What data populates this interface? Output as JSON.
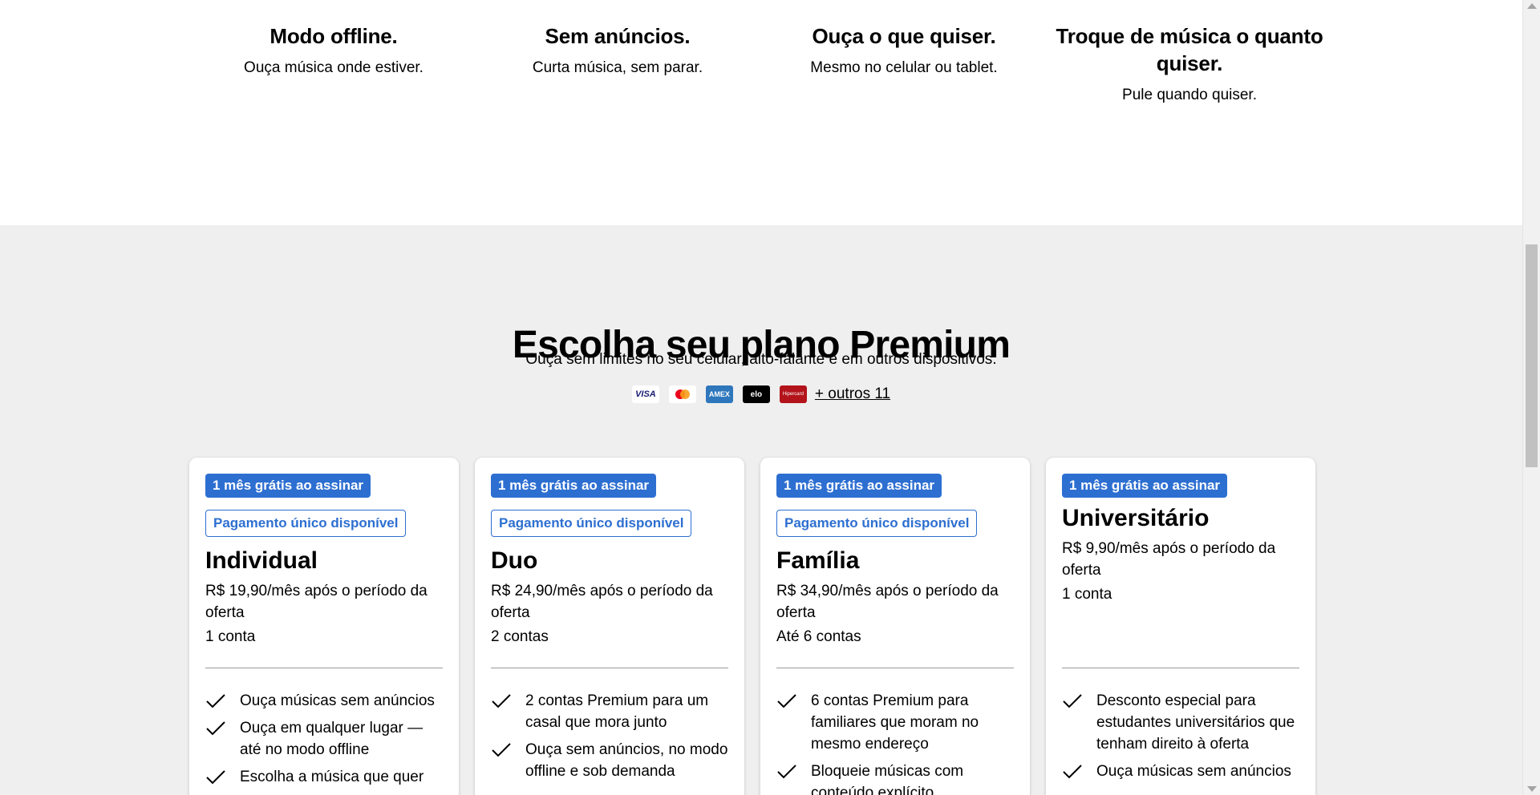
{
  "benefits": [
    {
      "title": "Modo offline.",
      "text": "Ouça música onde estiver."
    },
    {
      "title": "Sem anúncios.",
      "text": "Curta música, sem parar."
    },
    {
      "title": "Ouça o que quiser.",
      "text": "Mesmo no celular ou tablet."
    },
    {
      "title": "Troque de música o quanto quiser.",
      "text": "Pule quando quiser."
    }
  ],
  "premium": {
    "title": "Escolha seu plano Premium",
    "subtitle": "Ouça sem limites no seu celular, alto-falante e em outros dispositivos.",
    "payment_logos": [
      {
        "name": "visa-logo",
        "label": "VISA",
        "bg": "#ffffff",
        "fg": "#1a1f71"
      },
      {
        "name": "mastercard-logo",
        "label": "",
        "bg": "#ffffff",
        "fg": "#eb001b"
      },
      {
        "name": "amex-logo",
        "label": "AMEX",
        "bg": "#2e77bc",
        "fg": "#ffffff"
      },
      {
        "name": "elo-logo",
        "label": "elo",
        "bg": "#000000",
        "fg": "#ffffff"
      },
      {
        "name": "hipercard-logo",
        "label": "Hipercard",
        "bg": "#b3131b",
        "fg": "#ffffff"
      }
    ],
    "more_payments": "+ outros 11"
  },
  "plans": [
    {
      "badge": "1 mês grátis ao assinar",
      "badge2": "Pagamento único disponível",
      "name": "Individual",
      "price": "R$ 19,90/mês após o período da oferta",
      "accounts": "1 conta",
      "features": [
        "Ouça músicas sem anúncios",
        "Ouça em qualquer lugar — até no modo offline",
        "Escolha a música que quer"
      ]
    },
    {
      "badge": "1 mês grátis ao assinar",
      "badge2": "Pagamento único disponível",
      "name": "Duo",
      "price": "R$ 24,90/mês após o período da oferta",
      "accounts": "2 contas",
      "features": [
        "2 contas Premium para um casal que mora junto",
        "Ouça sem anúncios, no modo offline e sob demanda"
      ]
    },
    {
      "badge": "1 mês grátis ao assinar",
      "badge2": "Pagamento único disponível",
      "name": "Família",
      "price": "R$ 34,90/mês após o período da oferta",
      "accounts": "Até 6 contas",
      "features": [
        "6 contas Premium para familiares que moram no mesmo endereço",
        "Bloqueie músicas com conteúdo explícito"
      ]
    },
    {
      "badge": "1 mês grátis ao assinar",
      "badge2": "",
      "name": "Universitário",
      "price": "R$ 9,90/mês após o período da oferta",
      "accounts": "1 conta",
      "features": [
        "Desconto especial para estudantes universitários que tenham direito à oferta",
        "Ouça músicas sem anúncios"
      ]
    }
  ],
  "colors": {
    "accent": "#2d6fd1",
    "section_bg": "#efefef"
  }
}
